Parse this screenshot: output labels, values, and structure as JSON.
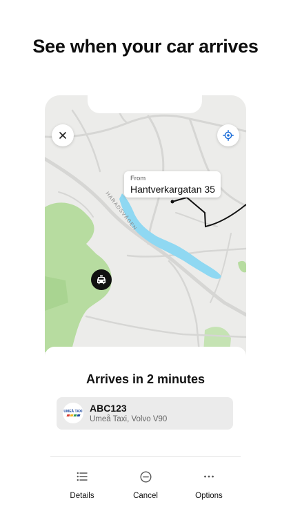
{
  "headline": "See when your car arrives",
  "map": {
    "road_label": "HARADSVÄGEN",
    "pickup": {
      "label": "From",
      "address": "Hantverkargatan 35"
    },
    "close_icon": "close-icon",
    "locate_icon": "locate-icon",
    "taxi_icon": "taxi-icon"
  },
  "sheet": {
    "title": "Arrives in 2 minutes",
    "vehicle": {
      "logo_text": "UMEÅ TAXI",
      "plate": "ABC123",
      "description": "Umeå Taxi, Volvo V90"
    },
    "actions": [
      {
        "label": "Details",
        "icon": "list-icon"
      },
      {
        "label": "Cancel",
        "icon": "cancel-circle-icon"
      },
      {
        "label": "Options",
        "icon": "more-dots-icon"
      }
    ]
  },
  "colors": {
    "map_land": "#ececea",
    "park": "#b7dca0",
    "water": "#8fd8f2",
    "road": "#d6d6d4",
    "route": "#111111",
    "logo_blue": "#1e4aa0",
    "logo_stripes": [
      "#d83a2e",
      "#f2b61e",
      "#2f9a4a",
      "#1e4aa0"
    ]
  }
}
